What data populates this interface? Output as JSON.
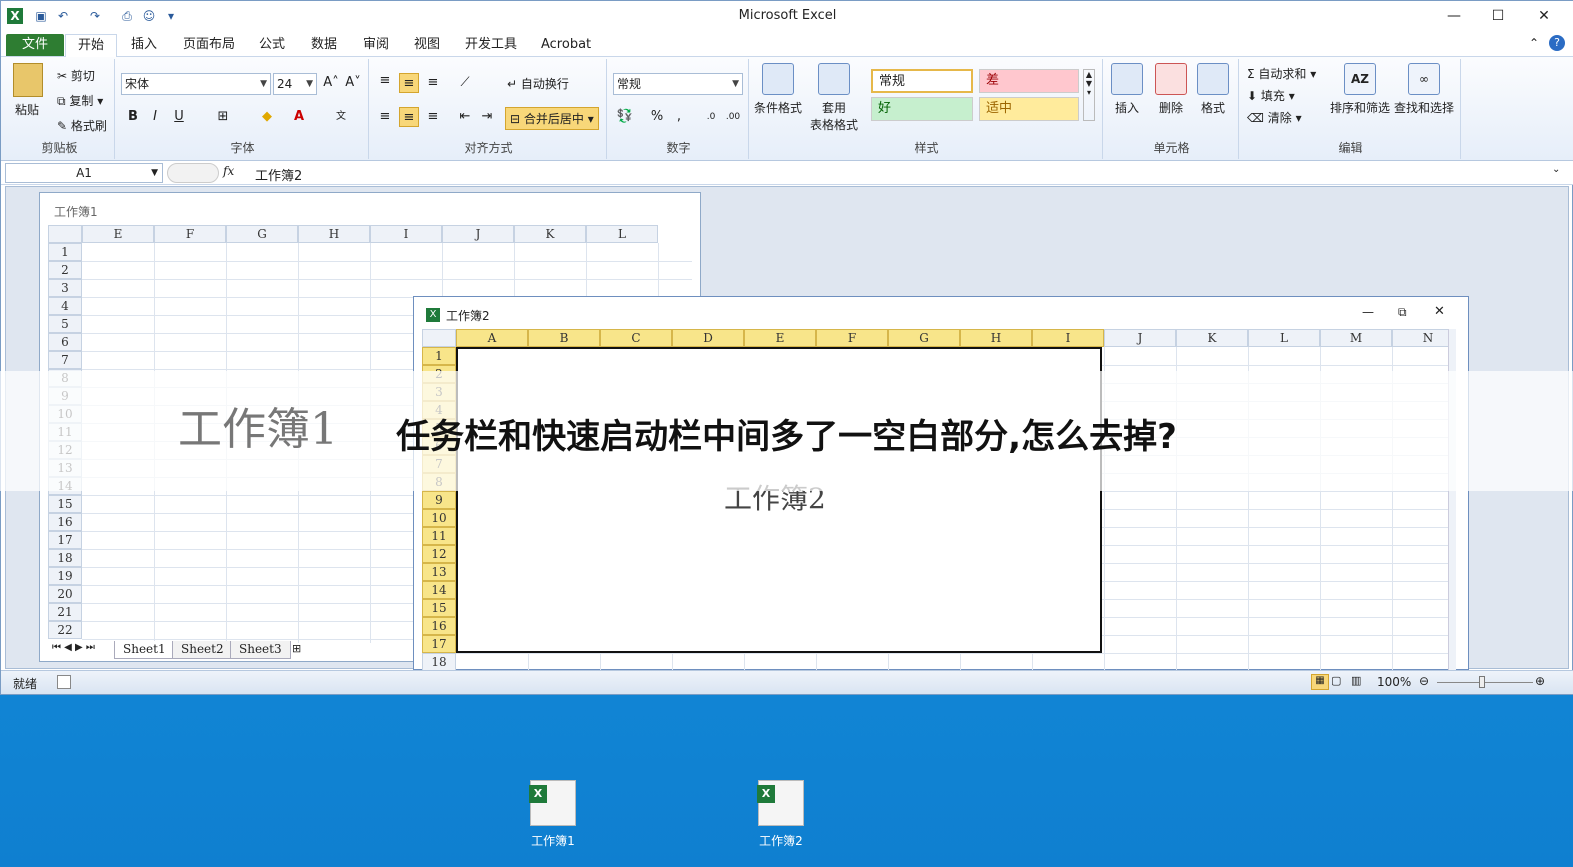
{
  "app": {
    "title": "Microsoft Excel",
    "window_controls": [
      "—",
      "☐",
      "✕"
    ]
  },
  "menu": {
    "tabs": [
      "文件",
      "开始",
      "插入",
      "页面布局",
      "公式",
      "数据",
      "审阅",
      "视图",
      "开发工具",
      "Acrobat"
    ],
    "active": "开始"
  },
  "ribbon": {
    "clipboard": {
      "paste": "粘贴",
      "cut": "剪切",
      "copy": "复制",
      "format_painter": "格式刷",
      "label": "剪贴板"
    },
    "font": {
      "name": "宋体",
      "size": "24",
      "label": "字体",
      "bold": "B",
      "italic": "I",
      "underline": "U"
    },
    "alignment": {
      "wrap": "自动换行",
      "merge": "合并后居中",
      "label": "对齐方式"
    },
    "number": {
      "format": "常规",
      "percent": "%",
      "comma": ",",
      "label": "数字"
    },
    "styles": {
      "conditional": "条件格式",
      "table1": "套用",
      "table2": "表格格式",
      "normal": "常规",
      "bad": "差",
      "good": "好",
      "neutral": "适中",
      "label": "样式"
    },
    "cells": {
      "insert": "插入",
      "delete": "删除",
      "format": "格式",
      "label": "单元格"
    },
    "editing": {
      "autosum": "自动求和",
      "fill": "填充",
      "clear": "清除",
      "sort": "排序和筛选",
      "find": "查找和选择",
      "label": "编辑"
    }
  },
  "formula_bar": {
    "name_box": "A1",
    "fx": "fx",
    "value": "工作簿2"
  },
  "workbook1": {
    "title": "工作簿1",
    "columns": [
      "E",
      "F",
      "G",
      "H",
      "I",
      "J",
      "K",
      "L"
    ],
    "rows": [
      "1",
      "2",
      "3",
      "4",
      "5",
      "6",
      "7",
      "8",
      "9",
      "10",
      "11",
      "12",
      "13",
      "14",
      "15",
      "16",
      "17",
      "18",
      "19",
      "20",
      "21",
      "22"
    ],
    "sheets": [
      "Sheet1",
      "Sheet2",
      "Sheet3"
    ],
    "watermark": "工作簿1"
  },
  "workbook2": {
    "title": "工作簿2",
    "columns": [
      "A",
      "B",
      "C",
      "D",
      "E",
      "F",
      "G",
      "H",
      "I",
      "J",
      "K",
      "L",
      "M",
      "N"
    ],
    "rows": [
      "1",
      "2",
      "3",
      "4",
      "5",
      "6",
      "7",
      "8",
      "9",
      "10",
      "11",
      "12",
      "13",
      "14",
      "15",
      "16",
      "17",
      "18"
    ],
    "cell_text": "工作簿2"
  },
  "status": {
    "ready": "就绪",
    "zoom": "100%"
  },
  "banner": {
    "text": "任务栏和快速启动栏中间多了一空白部分,怎么去掉?"
  },
  "desktop": {
    "icons": [
      "工作簿1",
      "工作簿2"
    ]
  },
  "colors": {
    "file_tab": "#2e7d32",
    "selection": "#f8e58a",
    "desktop": "#1590dc"
  }
}
